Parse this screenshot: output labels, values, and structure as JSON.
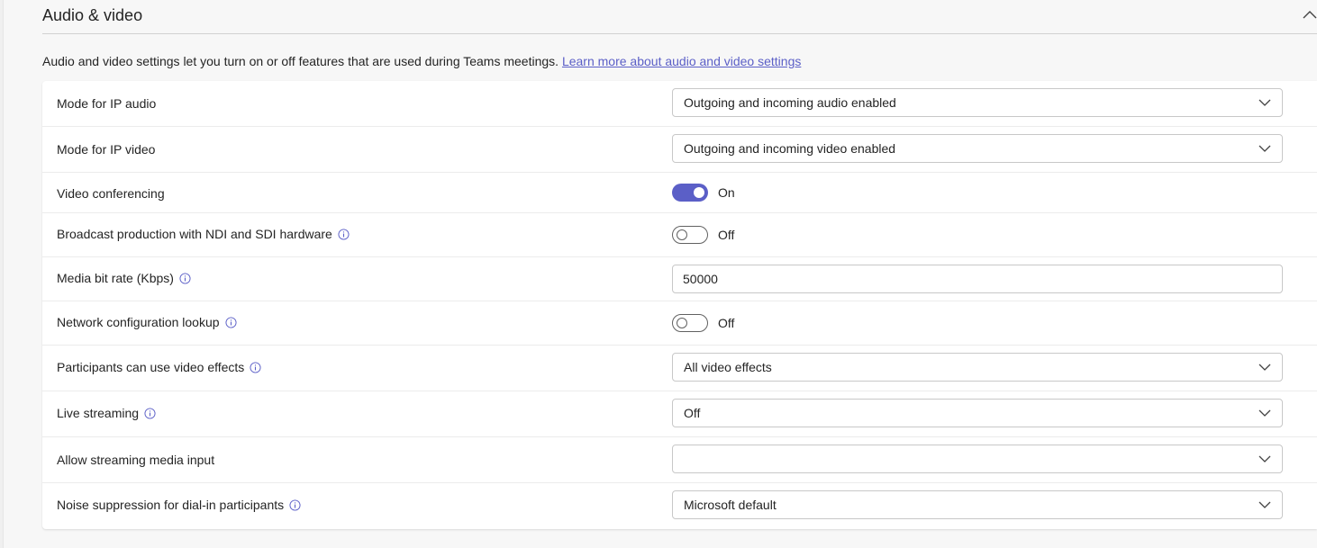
{
  "section": {
    "title": "Audio & video",
    "description": "Audio and video settings let you turn on or off features that are used during Teams meetings. ",
    "learn_more": "Learn more about audio and video settings"
  },
  "settings": [
    {
      "label": "Mode for IP audio",
      "control": "select",
      "value": "Outgoing and incoming audio enabled",
      "info": false
    },
    {
      "label": "Mode for IP video",
      "control": "select",
      "value": "Outgoing and incoming video enabled",
      "info": false
    },
    {
      "label": "Video conferencing",
      "control": "toggle",
      "state": "on",
      "value": "On",
      "info": false
    },
    {
      "label": "Broadcast production with NDI and SDI hardware",
      "control": "toggle",
      "state": "off",
      "value": "Off",
      "info": true
    },
    {
      "label": "Media bit rate (Kbps)",
      "control": "text",
      "value": "50000",
      "info": true
    },
    {
      "label": "Network configuration lookup",
      "control": "toggle",
      "state": "off",
      "value": "Off",
      "info": true
    },
    {
      "label": "Participants can use video effects",
      "control": "select",
      "value": "All video effects",
      "info": true
    },
    {
      "label": "Live streaming",
      "control": "select",
      "value": "Off",
      "info": true
    },
    {
      "label": "Allow streaming media input",
      "control": "select",
      "value": "",
      "info": false
    },
    {
      "label": "Noise suppression for dial-in participants",
      "control": "select",
      "value": "Microsoft default",
      "info": true
    }
  ],
  "colors": {
    "accent": "#5b5fc7",
    "link": "#5b5fc7",
    "text": "#242424",
    "info_icon": "#5b5fc7"
  },
  "icons": {
    "collapse": "chevron-up-icon",
    "dropdown": "chevron-down-icon",
    "info": "info-icon"
  }
}
